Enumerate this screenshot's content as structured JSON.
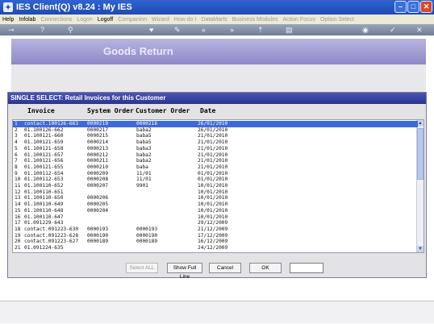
{
  "window": {
    "title": "IES Client(Q) v8.24 : My IES"
  },
  "menu": [
    {
      "label": "Help",
      "enabled": true
    },
    {
      "label": "Infolab",
      "enabled": true
    },
    {
      "label": "Connections",
      "enabled": false
    },
    {
      "label": "Logon",
      "enabled": false
    },
    {
      "label": "Logoff",
      "enabled": true
    },
    {
      "label": "Companion",
      "enabled": false
    },
    {
      "label": "Wizard",
      "enabled": false
    },
    {
      "label": "How do I",
      "enabled": false
    },
    {
      "label": "DataMarts",
      "enabled": false
    },
    {
      "label": "Business Modules",
      "enabled": false
    },
    {
      "label": "Action Focus",
      "enabled": false
    },
    {
      "label": "Option Select",
      "enabled": false
    }
  ],
  "toolbar": {
    "icons": [
      "key-icon",
      "help-icon",
      "search-icon",
      "heart-icon",
      "edit-icon",
      "back-icon",
      "forward-icon",
      "upload-icon",
      "document-icon",
      "globe-icon",
      "check-icon",
      "close-icon"
    ]
  },
  "banner": {
    "title": "Goods Return"
  },
  "dialog": {
    "title": "SINGLE SELECT: Retail Invoices for this Customer",
    "columns": [
      "Invoice",
      "System Order",
      "Customer Order",
      "Date"
    ],
    "rows": [
      {
        "n": "1",
        "invoice": "contact.100126-663",
        "sys": "0000219",
        "cust": "0000216",
        "date": "26/01/2010"
      },
      {
        "n": "2",
        "invoice": "01.100126-662",
        "sys": "0000217",
        "cust": "baba2",
        "date": "26/01/2010"
      },
      {
        "n": "3",
        "invoice": "01.100121-660",
        "sys": "0000215",
        "cust": "baba5",
        "date": "21/01/2010"
      },
      {
        "n": "4",
        "invoice": "01.100121-659",
        "sys": "0000214",
        "cust": "baba5",
        "date": "21/01/2010"
      },
      {
        "n": "5",
        "invoice": "01.100121-658",
        "sys": "0000213",
        "cust": "baba3",
        "date": "21/01/2010"
      },
      {
        "n": "6",
        "invoice": "01.100121-657",
        "sys": "0000212",
        "cust": "baba2",
        "date": "21/01/2010"
      },
      {
        "n": "7",
        "invoice": "01.100121-656",
        "sys": "0000211",
        "cust": "baba2",
        "date": "21/01/2010"
      },
      {
        "n": "8",
        "invoice": "01.100121-655",
        "sys": "0000210",
        "cust": "baba",
        "date": "21/01/2010"
      },
      {
        "n": "9",
        "invoice": "01.100112-654",
        "sys": "0000209",
        "cust": "11/01",
        "date": "01/01/2010"
      },
      {
        "n": "10",
        "invoice": "01.100112-653",
        "sys": "0000208",
        "cust": "11/01",
        "date": "01/01/2010"
      },
      {
        "n": "11",
        "invoice": "01.100110-652",
        "sys": "0000207",
        "cust": "9901",
        "date": "10/01/2010"
      },
      {
        "n": "12",
        "invoice": "01.100110-651",
        "sys": "",
        "cust": "",
        "date": "10/01/2010"
      },
      {
        "n": "13",
        "invoice": "01.100110-650",
        "sys": "0000206",
        "cust": "",
        "date": "10/01/2010"
      },
      {
        "n": "14",
        "invoice": "01.100110-649",
        "sys": "0000205",
        "cust": "",
        "date": "10/01/2010"
      },
      {
        "n": "15",
        "invoice": "01.100110-648",
        "sys": "0000204",
        "cust": "",
        "date": "10/01/2010"
      },
      {
        "n": "16",
        "invoice": "01.100110-647",
        "sys": "",
        "cust": "",
        "date": "10/01/2010"
      },
      {
        "n": "17",
        "invoice": "01.091229-643",
        "sys": "",
        "cust": "",
        "date": "29/12/2009"
      },
      {
        "n": "18",
        "invoice": "contact.091223-630",
        "sys": "0000193",
        "cust": "0000193",
        "date": "21/12/2009"
      },
      {
        "n": "19",
        "invoice": "contact.091223-628",
        "sys": "0000190",
        "cust": "0000190",
        "date": "17/12/2009"
      },
      {
        "n": "20",
        "invoice": "contact.091223-627",
        "sys": "0000189",
        "cust": "0000189",
        "date": "16/12/2009"
      },
      {
        "n": "21",
        "invoice": "01.091224-635",
        "sys": "",
        "cust": "",
        "date": "24/12/2009"
      }
    ],
    "buttons": {
      "select_all": "Select ALL",
      "show_full_line": "Show Full Line",
      "cancel": "Cancel",
      "ok": "OK"
    },
    "search_value": ""
  }
}
